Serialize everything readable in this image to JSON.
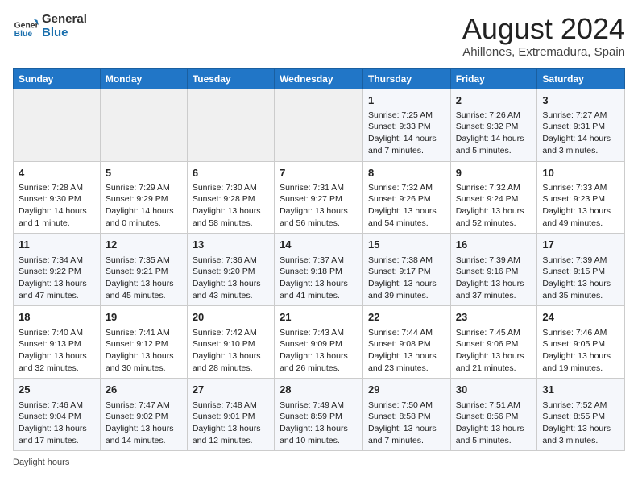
{
  "header": {
    "logo_general": "General",
    "logo_blue": "Blue",
    "month_year": "August 2024",
    "location": "Ahillones, Extremadura, Spain"
  },
  "days_of_week": [
    "Sunday",
    "Monday",
    "Tuesday",
    "Wednesday",
    "Thursday",
    "Friday",
    "Saturday"
  ],
  "weeks": [
    [
      {
        "day": "",
        "info": ""
      },
      {
        "day": "",
        "info": ""
      },
      {
        "day": "",
        "info": ""
      },
      {
        "day": "",
        "info": ""
      },
      {
        "day": "1",
        "info": "Sunrise: 7:25 AM\nSunset: 9:33 PM\nDaylight: 14 hours and 7 minutes."
      },
      {
        "day": "2",
        "info": "Sunrise: 7:26 AM\nSunset: 9:32 PM\nDaylight: 14 hours and 5 minutes."
      },
      {
        "day": "3",
        "info": "Sunrise: 7:27 AM\nSunset: 9:31 PM\nDaylight: 14 hours and 3 minutes."
      }
    ],
    [
      {
        "day": "4",
        "info": "Sunrise: 7:28 AM\nSunset: 9:30 PM\nDaylight: 14 hours and 1 minute."
      },
      {
        "day": "5",
        "info": "Sunrise: 7:29 AM\nSunset: 9:29 PM\nDaylight: 14 hours and 0 minutes."
      },
      {
        "day": "6",
        "info": "Sunrise: 7:30 AM\nSunset: 9:28 PM\nDaylight: 13 hours and 58 minutes."
      },
      {
        "day": "7",
        "info": "Sunrise: 7:31 AM\nSunset: 9:27 PM\nDaylight: 13 hours and 56 minutes."
      },
      {
        "day": "8",
        "info": "Sunrise: 7:32 AM\nSunset: 9:26 PM\nDaylight: 13 hours and 54 minutes."
      },
      {
        "day": "9",
        "info": "Sunrise: 7:32 AM\nSunset: 9:24 PM\nDaylight: 13 hours and 52 minutes."
      },
      {
        "day": "10",
        "info": "Sunrise: 7:33 AM\nSunset: 9:23 PM\nDaylight: 13 hours and 49 minutes."
      }
    ],
    [
      {
        "day": "11",
        "info": "Sunrise: 7:34 AM\nSunset: 9:22 PM\nDaylight: 13 hours and 47 minutes."
      },
      {
        "day": "12",
        "info": "Sunrise: 7:35 AM\nSunset: 9:21 PM\nDaylight: 13 hours and 45 minutes."
      },
      {
        "day": "13",
        "info": "Sunrise: 7:36 AM\nSunset: 9:20 PM\nDaylight: 13 hours and 43 minutes."
      },
      {
        "day": "14",
        "info": "Sunrise: 7:37 AM\nSunset: 9:18 PM\nDaylight: 13 hours and 41 minutes."
      },
      {
        "day": "15",
        "info": "Sunrise: 7:38 AM\nSunset: 9:17 PM\nDaylight: 13 hours and 39 minutes."
      },
      {
        "day": "16",
        "info": "Sunrise: 7:39 AM\nSunset: 9:16 PM\nDaylight: 13 hours and 37 minutes."
      },
      {
        "day": "17",
        "info": "Sunrise: 7:39 AM\nSunset: 9:15 PM\nDaylight: 13 hours and 35 minutes."
      }
    ],
    [
      {
        "day": "18",
        "info": "Sunrise: 7:40 AM\nSunset: 9:13 PM\nDaylight: 13 hours and 32 minutes."
      },
      {
        "day": "19",
        "info": "Sunrise: 7:41 AM\nSunset: 9:12 PM\nDaylight: 13 hours and 30 minutes."
      },
      {
        "day": "20",
        "info": "Sunrise: 7:42 AM\nSunset: 9:10 PM\nDaylight: 13 hours and 28 minutes."
      },
      {
        "day": "21",
        "info": "Sunrise: 7:43 AM\nSunset: 9:09 PM\nDaylight: 13 hours and 26 minutes."
      },
      {
        "day": "22",
        "info": "Sunrise: 7:44 AM\nSunset: 9:08 PM\nDaylight: 13 hours and 23 minutes."
      },
      {
        "day": "23",
        "info": "Sunrise: 7:45 AM\nSunset: 9:06 PM\nDaylight: 13 hours and 21 minutes."
      },
      {
        "day": "24",
        "info": "Sunrise: 7:46 AM\nSunset: 9:05 PM\nDaylight: 13 hours and 19 minutes."
      }
    ],
    [
      {
        "day": "25",
        "info": "Sunrise: 7:46 AM\nSunset: 9:04 PM\nDaylight: 13 hours and 17 minutes."
      },
      {
        "day": "26",
        "info": "Sunrise: 7:47 AM\nSunset: 9:02 PM\nDaylight: 13 hours and 14 minutes."
      },
      {
        "day": "27",
        "info": "Sunrise: 7:48 AM\nSunset: 9:01 PM\nDaylight: 13 hours and 12 minutes."
      },
      {
        "day": "28",
        "info": "Sunrise: 7:49 AM\nSunset: 8:59 PM\nDaylight: 13 hours and 10 minutes."
      },
      {
        "day": "29",
        "info": "Sunrise: 7:50 AM\nSunset: 8:58 PM\nDaylight: 13 hours and 7 minutes."
      },
      {
        "day": "30",
        "info": "Sunrise: 7:51 AM\nSunset: 8:56 PM\nDaylight: 13 hours and 5 minutes."
      },
      {
        "day": "31",
        "info": "Sunrise: 7:52 AM\nSunset: 8:55 PM\nDaylight: 13 hours and 3 minutes."
      }
    ]
  ],
  "footer": {
    "daylight_hours": "Daylight hours"
  }
}
